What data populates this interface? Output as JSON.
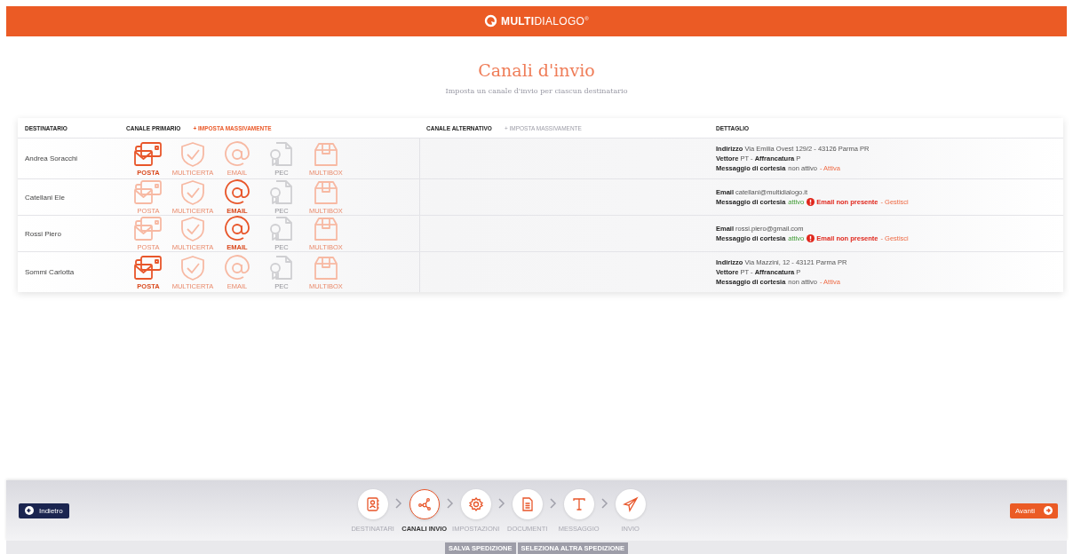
{
  "header": {
    "logo": "**MULTI**DIALOGO$^{®}$"
  },
  "page": {
    "title": "Canali d'invio",
    "subtitle": "Imposta un canale d'invio per ciascun destinatario"
  },
  "table": {
    "columns": [
      {
        "label": "DESTINATARIO"
      },
      {
        "label": "CANALE PRIMARIO",
        "action": {
          "label": "+ IMPOSTA MASSIVAMENTE",
          "disabled": false
        }
      },
      {
        "label": "CANALE ALTERNATIVO",
        "action": {
          "label": "+ IMPOSTA MASSIVAMENTE",
          "disabled": true
        }
      },
      {
        "label": "DETTAGLIO"
      }
    ],
    "rows": [
      {
        "name": "Andrea Soracchi",
        "channels": [
          {
            "kind": "posta",
            "label": "POSTA",
            "selected": true,
            "disabled": false
          },
          {
            "kind": "multicerta",
            "label": "MULTICERTA",
            "selected": false,
            "disabled": false
          },
          {
            "kind": "email",
            "label": "EMAIL",
            "selected": false,
            "disabled": false
          },
          {
            "kind": "pec",
            "label": "PEC",
            "selected": false,
            "disabled": true
          },
          {
            "kind": "multibox",
            "label": "MULTIBOX",
            "selected": false,
            "disabled": false
          }
        ],
        "details": [
          {
            "text": "**Indirizzo** Via Emilia Ovest 129/2 - 43126 Parma PR"
          },
          {
            "text": "**Vettore** PT - **Affrancatura** P"
          },
          {
            "text": "**Messaggio di cortesia**",
            "state": {
              "text": "non attivo",
              "on": false
            },
            "link": "- Attiva"
          }
        ]
      },
      {
        "name": "Catellani Ele",
        "channels": [
          {
            "kind": "posta",
            "label": "POSTA",
            "selected": false,
            "disabled": false
          },
          {
            "kind": "multicerta",
            "label": "MULTICERTA",
            "selected": false,
            "disabled": false
          },
          {
            "kind": "email",
            "label": "EMAIL",
            "selected": true,
            "disabled": false
          },
          {
            "kind": "pec",
            "label": "PEC",
            "selected": false,
            "disabled": true
          },
          {
            "kind": "multibox",
            "label": "MULTIBOX",
            "selected": false,
            "disabled": false
          }
        ],
        "details": [
          {
            "text": "**Email** catellani@multidialogo.it"
          },
          {
            "text": "**Messaggio di cortesia**",
            "state": {
              "text": "attivo",
              "on": true
            },
            "warning": "Email non presente",
            "link": "- Gestisci"
          }
        ]
      },
      {
        "name": "Rossi Piero",
        "channels": [
          {
            "kind": "posta",
            "label": "POSTA",
            "selected": false,
            "disabled": false
          },
          {
            "kind": "multicerta",
            "label": "MULTICERTA",
            "selected": false,
            "disabled": false
          },
          {
            "kind": "email",
            "label": "EMAIL",
            "selected": true,
            "disabled": false
          },
          {
            "kind": "pec",
            "label": "PEC",
            "selected": false,
            "disabled": true
          },
          {
            "kind": "multibox",
            "label": "MULTIBOX",
            "selected": false,
            "disabled": false
          }
        ],
        "details": [
          {
            "text": "**Email** rossi.piero@gmail.com"
          },
          {
            "text": "**Messaggio di cortesia**",
            "state": {
              "text": "attivo",
              "on": true
            },
            "warning": "Email non presente",
            "link": "- Gestisci"
          }
        ]
      },
      {
        "name": "Sommi Carlotta",
        "channels": [
          {
            "kind": "posta",
            "label": "POSTA",
            "selected": true,
            "disabled": false
          },
          {
            "kind": "multicerta",
            "label": "MULTICERTA",
            "selected": false,
            "disabled": false
          },
          {
            "kind": "email",
            "label": "EMAIL",
            "selected": false,
            "disabled": false
          },
          {
            "kind": "pec",
            "label": "PEC",
            "selected": false,
            "disabled": true
          },
          {
            "kind": "multibox",
            "label": "MULTIBOX",
            "selected": false,
            "disabled": false
          }
        ],
        "details": [
          {
            "text": "**Indirizzo** Via Mazzini, 12 - 43121 Parma PR"
          },
          {
            "text": "**Vettore** PT - **Affrancatura** P"
          },
          {
            "text": "**Messaggio di cortesia**",
            "state": {
              "text": "non attivo",
              "on": false
            },
            "link": "- Attiva"
          }
        ]
      }
    ]
  },
  "footer": {
    "back": "Indietro",
    "next": "Avanti",
    "steps": [
      {
        "kind": "recipients",
        "label": "DESTINATARI",
        "selected": false
      },
      {
        "kind": "channels",
        "label": "CANALI INVIO",
        "selected": true
      },
      {
        "kind": "settings",
        "label": "IMPOSTAZIONI",
        "selected": false
      },
      {
        "kind": "document",
        "label": "DOCUMENTI",
        "selected": false
      },
      {
        "kind": "message",
        "label": "MESSAGGIO",
        "selected": false
      },
      {
        "kind": "send",
        "label": "INVIO",
        "selected": false
      }
    ],
    "actions": [
      "SALVA SPEDIZIONE",
      "SELEZIONA ALTRA SPEDIZIONE"
    ]
  }
}
